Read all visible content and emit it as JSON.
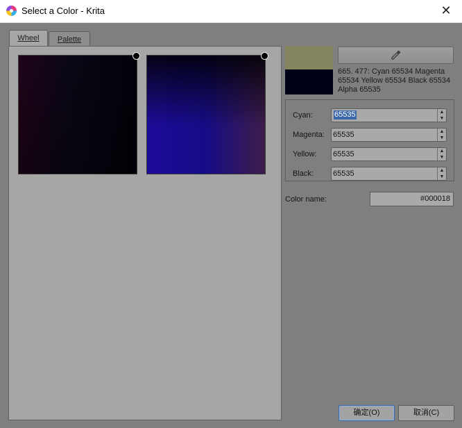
{
  "window": {
    "title": "Select a Color - Krita",
    "close_glyph": "✕"
  },
  "tabs": [
    {
      "label": "Wheel",
      "active": true
    },
    {
      "label": "Palette",
      "active": false
    }
  ],
  "icons": {
    "app": "krita-logo-icon",
    "picker": "eyedropper-icon",
    "spin_up": "▲",
    "spin_down": "▼"
  },
  "swatches": {
    "current": "#84845f",
    "previous": "#000018"
  },
  "color_info": "665. 477: Cyan 65534 Magenta 65534 Yellow 65534 Black 65534 Alpha 65535",
  "channels": [
    {
      "label": "Cyan:",
      "value": "65535"
    },
    {
      "label": "Magenta:",
      "value": "65535"
    },
    {
      "label": "Yellow:",
      "value": "65535"
    },
    {
      "label": "Black:",
      "value": "65535"
    }
  ],
  "color_name": {
    "label": "Color name:",
    "value": "#000018"
  },
  "buttons": {
    "ok": "确定(O)",
    "cancel": "取消(C)"
  }
}
